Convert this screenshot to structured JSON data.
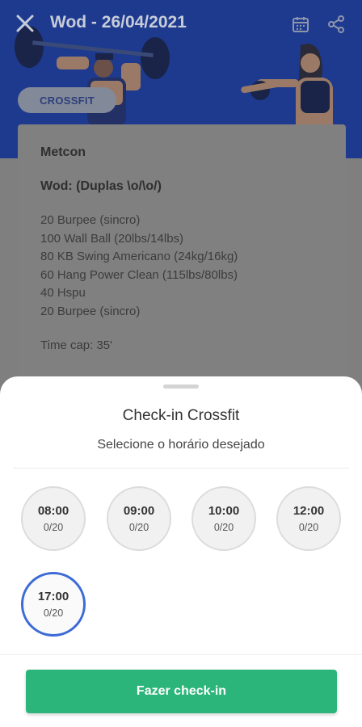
{
  "header": {
    "title": "Wod - 26/04/2021",
    "tag": "CROSSFIT",
    "icons": [
      "close-icon",
      "calendar-icon",
      "share-icon"
    ]
  },
  "workout": {
    "section": "Metcon",
    "subtitle": "Wod: (Duplas \\o/\\o/)",
    "lines": [
      "20 Burpee (sincro)",
      "100 Wall Ball (20lbs/14lbs)",
      "80 KB Swing Americano (24kg/16kg)",
      "60 Hang Power Clean (115lbs/80lbs)",
      "40 Hspu",
      "20 Burpee (sincro)"
    ],
    "time_cap": "Time cap: 35'"
  },
  "sheet": {
    "title": "Check-in Crossfit",
    "subtitle": "Selecione o horário desejado",
    "slots": [
      {
        "time": "08:00",
        "count": "0/20"
      },
      {
        "time": "09:00",
        "count": "0/20"
      },
      {
        "time": "10:00",
        "count": "0/20"
      },
      {
        "time": "12:00",
        "count": "0/20"
      },
      {
        "time": "17:00",
        "count": "0/20",
        "selected": true
      }
    ],
    "button_label": "Fazer check-in"
  },
  "colors": {
    "accent_green": "#2cb57a",
    "selected_ring": "#3d6bd6",
    "header_blue": "#2a4db8"
  }
}
